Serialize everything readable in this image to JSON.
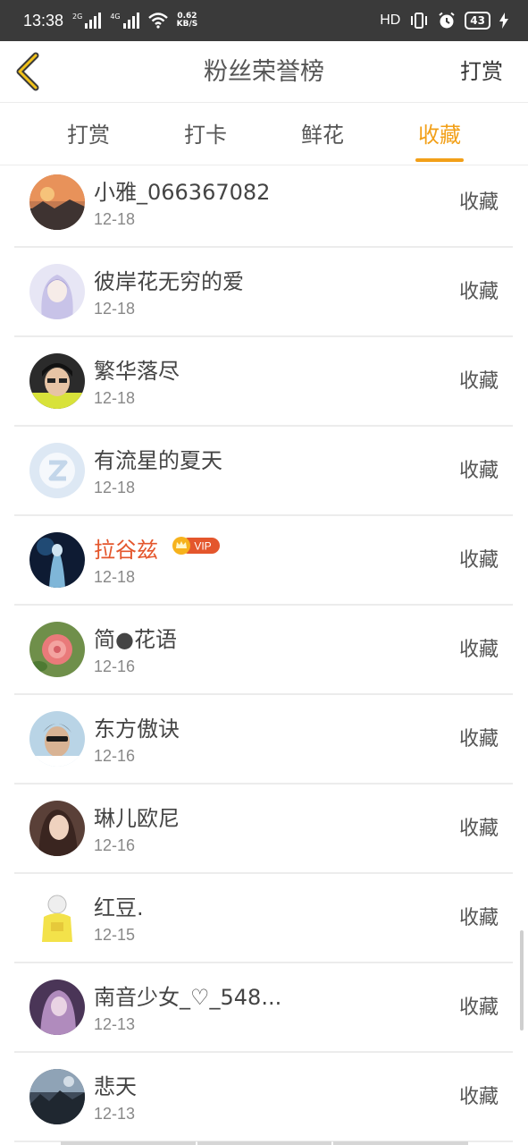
{
  "status": {
    "time": "13:38",
    "net_speed_value": "0.62",
    "net_speed_unit": "KB/S",
    "sim1": "2G",
    "sim2": "4G",
    "hd": "HD",
    "battery": "43"
  },
  "navbar": {
    "title": "粉丝荣誉榜",
    "right_label": "打赏"
  },
  "tabs": [
    {
      "label": "打赏"
    },
    {
      "label": "打卡"
    },
    {
      "label": "鲜花"
    },
    {
      "label": "收藏"
    }
  ],
  "active_tab": "收藏",
  "accent_color": "#f2a019",
  "vip_color": "#e4562c",
  "list": [
    {
      "name": "小雅_066367082",
      "date": "12-18",
      "action": "收藏",
      "vip": false
    },
    {
      "name": "彼岸花无穷的爱",
      "date": "12-18",
      "action": "收藏",
      "vip": false
    },
    {
      "name": "繁华落尽",
      "date": "12-18",
      "action": "收藏",
      "vip": false
    },
    {
      "name": "有流星的夏天",
      "date": "12-18",
      "action": "收藏",
      "vip": false
    },
    {
      "name": "拉谷兹",
      "date": "12-18",
      "action": "收藏",
      "vip": true,
      "badge": "VIP"
    },
    {
      "name": "简●花语",
      "date": "12-16",
      "action": "收藏",
      "vip": false
    },
    {
      "name": "东方傲诀",
      "date": "12-16",
      "action": "收藏",
      "vip": false
    },
    {
      "name": "琳儿欧尼",
      "date": "12-16",
      "action": "收藏",
      "vip": false
    },
    {
      "name": "红豆.",
      "date": "12-15",
      "action": "收藏",
      "vip": false
    },
    {
      "name": "南音少女_♡_548...",
      "date": "12-13",
      "action": "收藏",
      "vip": false
    },
    {
      "name": "悲天",
      "date": "12-13",
      "action": "收藏",
      "vip": false
    }
  ]
}
